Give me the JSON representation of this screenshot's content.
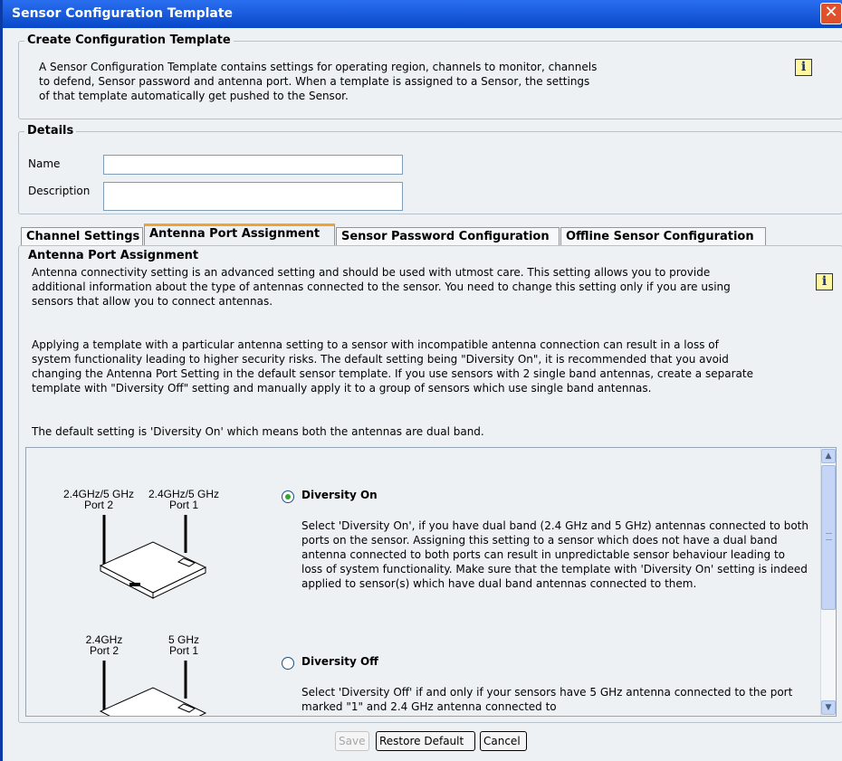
{
  "window": {
    "title": "Sensor Configuration Template",
    "close_glyph": "✕"
  },
  "create_section": {
    "legend": "Create Configuration Template",
    "description": "A Sensor Configuration Template contains settings for operating region, channels to monitor, channels to defend, Sensor password and antenna port. When a template is assigned to a Sensor, the settings of that template automatically get pushed to the Sensor.",
    "info_glyph": "i"
  },
  "details": {
    "legend": "Details",
    "name_label": "Name",
    "name_value": "",
    "description_label": "Description",
    "description_value": ""
  },
  "tabs": [
    {
      "label": "Channel Settings",
      "active": false
    },
    {
      "label": "Antenna Port Assignment",
      "active": true
    },
    {
      "label": "Sensor Password Configuration",
      "active": false
    },
    {
      "label": "Offline Sensor Configuration",
      "active": false
    }
  ],
  "antenna_panel": {
    "title": "Antenna Port Assignment",
    "info_glyph": "i",
    "paragraph1": "Antenna connectivity setting is an advanced setting and should be used with utmost care. This setting allows you to provide additional information about the type of antennas connected to the sensor. You need to change this setting only if you are using sensors that allow you to connect antennas.",
    "paragraph2": "Applying a template with a particular antenna setting to a sensor with incompatible antenna connection can result in a loss of system functionality leading to higher security risks. The default setting being \"Diversity On\", it is recommended that you avoid changing the Antenna Port Setting in the default sensor template. If you use sensors with 2 single band antennas, create a separate template with \"Diversity Off\" setting and manually apply it to a group of sensors which use single band antennas.",
    "default_note": "The default setting is 'Diversity On' which means both the antennas are dual band.",
    "options": [
      {
        "title": "Diversity On",
        "selected": true,
        "port2_freq": "2.4GHz/5 GHz",
        "port2_name": "Port 2",
        "port1_freq": "2.4GHz/5 GHz",
        "port1_name": "Port 1",
        "description": "Select 'Diversity On', if you have dual band (2.4 GHz and 5 GHz) antennas connected to both ports on the sensor. Assigning this setting to a sensor which does not have a dual band antenna connected to both ports can result in unpredictable sensor behaviour leading to loss of system functionality. Make sure that the template with 'Diversity On' setting is indeed applied to sensor(s) which have dual band antennas connected to them."
      },
      {
        "title": "Diversity Off",
        "selected": false,
        "port2_freq": "2.4GHz",
        "port2_name": "Port 2",
        "port1_freq": "5 GHz",
        "port1_name": "Port 1",
        "description": "Select 'Diversity Off' if and only if your sensors have 5 GHz antenna connected to the port marked \"1\" and 2.4 GHz antenna connected to"
      }
    ]
  },
  "buttons": {
    "save": "Save",
    "restore_default": "Restore Default",
    "cancel": "Cancel"
  },
  "scrollbar": {
    "up_glyph": "▲",
    "down_glyph": "▼"
  },
  "colors": {
    "titlebar": "#0a55d8",
    "active_tab_accent": "#f2a230",
    "radio_selected": "#2ea82e",
    "window_bg": "#edf1f4"
  }
}
